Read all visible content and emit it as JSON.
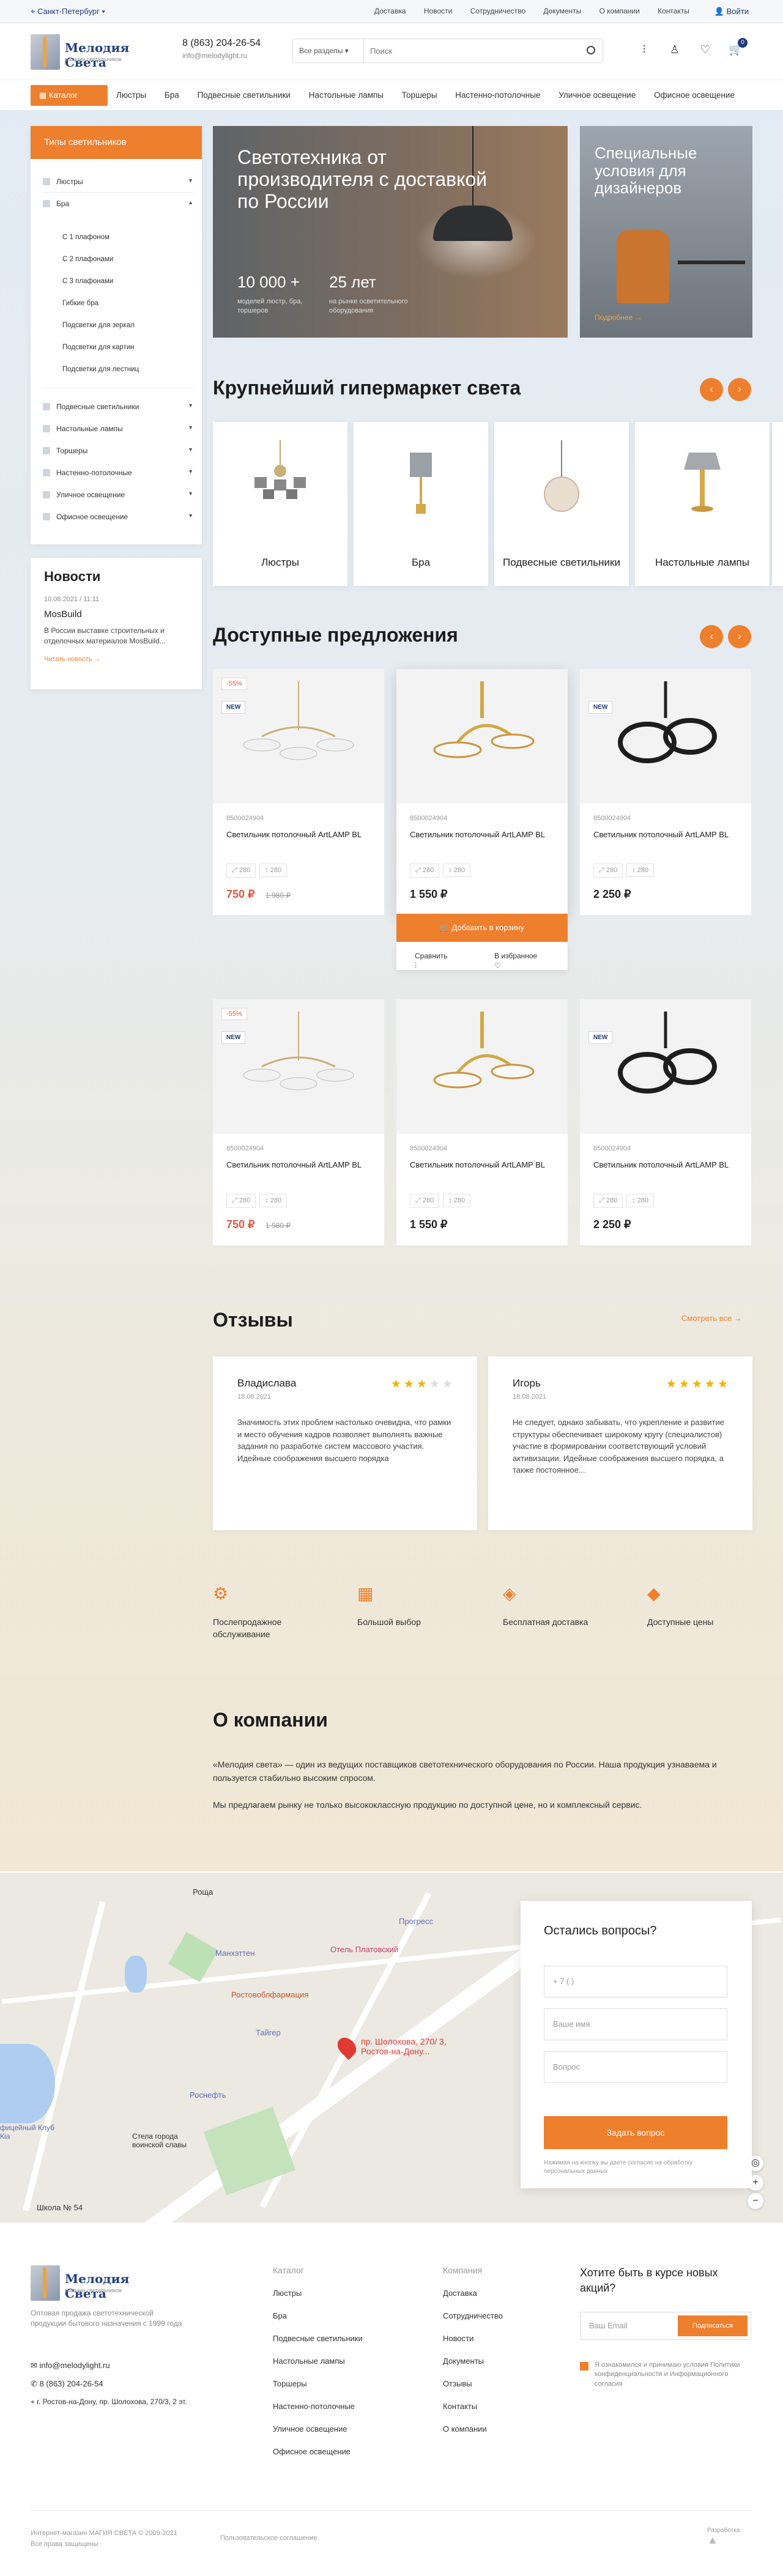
{
  "topbar": {
    "city": "Санкт-Петербург",
    "menu": [
      "Доставка",
      "Новости",
      "Сотрудничество",
      "Документы",
      "О компании",
      "Контакты"
    ],
    "login": "Войти"
  },
  "header": {
    "logo_text": "Мелодия Света",
    "logo_sub": "магазин светильников",
    "phone": "8 (863) 204-26-54",
    "email": "info@melodylight.ru",
    "search_scope": "Все разделы",
    "search_placeholder": "Поиск",
    "cart_count": "0"
  },
  "nav": {
    "catalog": "Каталог",
    "items": [
      "Люстры",
      "Бра",
      "Подвесные светильники",
      "Настольные лампы",
      "Торшеры",
      "Настенно-потолочные",
      "Уличное освещение",
      "Офисное освещение"
    ]
  },
  "sidebar": {
    "title": "Типы светильников",
    "top": [
      "Люстры",
      "Бра"
    ],
    "sub": [
      "С 1 плафоном",
      "С 2 плафонами",
      "С 3 плафонами",
      "Гибкие бра",
      "Подсветки для зеркал",
      "Подсветки для картин",
      "Подсветки для лестниц"
    ],
    "bottom": [
      "Подвесные светильники",
      "Настольные лампы",
      "Торшеры",
      "Настенно-потолочные",
      "Уличное освещение",
      "Офисное освещение"
    ]
  },
  "news": {
    "title": "Новости",
    "date": "10.08.2021 / 11:11",
    "item_title": "MosBuild",
    "text": "В России выставке строительных и отделочных материалов MosBuild...",
    "more": "Читать новость"
  },
  "hero": {
    "title": "Светотехника от производителя с доставкой по России",
    "n1": "10 000 +",
    "l1": "моделей люстр, бра, торшеров",
    "n2": "25 лет",
    "l2": "на рынке осветительного оборудования"
  },
  "hero2": {
    "title": "Специальные условия для дизайнеров",
    "more": "Подробнее"
  },
  "categories": {
    "title": "Крупнейший гипермаркет света",
    "items": [
      "Люстры",
      "Бра",
      "Подвесные светильники",
      "Настольные лампы"
    ]
  },
  "offers": {
    "title": "Доступные предложения",
    "products": [
      {
        "sale": "-55%",
        "new": "NEW",
        "art": "8500024904",
        "name": "Светильник потолочный ArtLAMP BL",
        "s1": "280",
        "s2": "280",
        "price": "750 ₽",
        "old": "1 980 ₽"
      },
      {
        "sale": "",
        "new": "",
        "art": "8500024904",
        "name": "Светильник потолочный ArtLAMP BL",
        "s1": "280",
        "s2": "280",
        "price": "1 550 ₽",
        "old": ""
      },
      {
        "sale": "",
        "new": "NEW",
        "art": "8500024904",
        "name": "Светильник потолочный ArtLAMP BL",
        "s1": "280",
        "s2": "280",
        "price": "2 250 ₽",
        "old": ""
      }
    ],
    "add_to_cart": "Добавить в корзину",
    "compare": "Сравнить",
    "favorite": "В избранное"
  },
  "reviews": {
    "title": "Отзывы",
    "see_all": "Смотреть все",
    "items": [
      {
        "name": "Владислава",
        "date": "18.08.2021",
        "rating": 3,
        "text": "Значимость этих проблем настолько очевидна, что рамки и место обучения кадров позволяет выполнять важные задания по разработке систем массового участия. Идейные соображения высшего порядка"
      },
      {
        "name": "Игорь",
        "date": "18.08.2021",
        "rating": 5,
        "text": "Не следует, однако забывать, что укрепление и развитие структуры обеспечивает широкому кругу (специалистов) участие в формировании соответствующий условий активизации. Идейные соображения высшего порядка, а также постоянное..."
      }
    ]
  },
  "features": [
    "Послепродажное обслуживание",
    "Большой выбор",
    "Бесплатная доставка",
    "Доступные цены"
  ],
  "about": {
    "title": "О компании",
    "p1": "«Мелодия света» — один из ведущих поставщиков светотехнического оборудования по России. Наша продукция узнаваема и пользуется стабильно высоким спросом.",
    "p2": "Мы предлагаем рынку не только высококлассную продукцию по доступной цене, но и комплексный сервис."
  },
  "map": {
    "labels": [
      "Роща",
      "Прогресс",
      "Манхэттен",
      "Отель Платовский",
      "Ростовоблфармация",
      "Тайгер",
      "Роснефть",
      "Стела города воинской славы",
      "Школа № 54",
      "фицейный Клуб Кia",
      "пр. Шолохова, 270/ 3, Ростов-на-Дону..."
    ]
  },
  "form": {
    "title": "Остались вопросы?",
    "phone": "+ 7 (   )",
    "name": "Ваше имя",
    "question": "Вопрос",
    "button": "Задать вопрос",
    "note": "Нажимая на кнопку вы даете согласие на обработку персональных данных"
  },
  "footer": {
    "desc": "Оптовая продажа светотехнической продукции бытового назначения с 1999 года",
    "email": "info@melodylight.ru",
    "phone": "8 (863) 204-26-54",
    "address": "г. Ростов-на-Дону, пр. Шолохова, 270/3, 2 эт.",
    "catalog_h": "Каталог",
    "catalog": [
      "Люстры",
      "Бра",
      "Подвесные светильники",
      "Настольные лампы",
      "Торшеры",
      "Настенно-потолочные",
      "Уличное освещение",
      "Офисное освещение"
    ],
    "company_h": "Компания",
    "company": [
      "Доставка",
      "Сотрудничество",
      "Новости",
      "Документы",
      "Отзывы",
      "Контакты",
      "О компании"
    ],
    "subscribe_title": "Хотите быть в курсе новых акций?",
    "subscribe_placeholder": "Ваш Email",
    "subscribe_btn": "Подписаться",
    "consent": "Я ознакомился и принимаю условия Политики конфиденциальности и Информационного согласия",
    "copyright": "Интернет-магазин МАГИЯ СВЕТА © 2009-2021 Все права защищены",
    "policy": "Пользовательское соглашение",
    "dev": "Разработка"
  },
  "colors": {
    "accent": "#ee7f2d",
    "brand": "#1f3b7a",
    "sale": "#e05a45"
  }
}
